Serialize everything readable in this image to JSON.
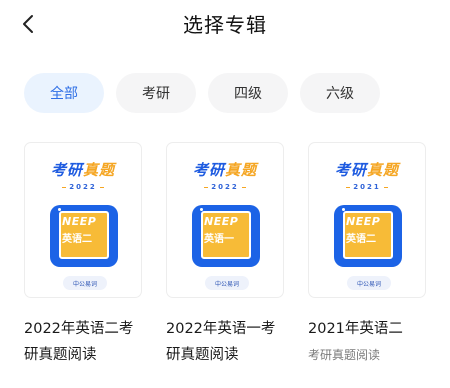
{
  "header": {
    "title": "选择专辑"
  },
  "filters": [
    "全部",
    "考研",
    "四级",
    "六级"
  ],
  "albums": [
    {
      "cover": {
        "brand_a": "考研",
        "brand_b": "真题",
        "year": "2022",
        "neep": "NEEP",
        "subject": "英语二",
        "publisher": "中公易词"
      },
      "title_line1": "2022年英语二考",
      "title_line2": "研真题阅读",
      "subtitle": ""
    },
    {
      "cover": {
        "brand_a": "考研",
        "brand_b": "真题",
        "year": "2022",
        "neep": "NEEP",
        "subject": "英语一",
        "publisher": "中公易词"
      },
      "title_line1": "2022年英语一考",
      "title_line2": "研真题阅读",
      "subtitle": ""
    },
    {
      "cover": {
        "brand_a": "考研",
        "brand_b": "真题",
        "year": "2021",
        "neep": "NEEP",
        "subject": "英语二",
        "publisher": "中公易词"
      },
      "title_line1": "2021年英语二",
      "title_line2": "",
      "subtitle": "考研真题阅读"
    }
  ],
  "colors": {
    "accent": "#2f6fe6",
    "chip_bg": "#f5f5f6",
    "chip_active_bg": "#eaf3fe",
    "brand_blue": "#1e5be0",
    "brand_yellow": "#f5a623"
  },
  "icons": {
    "back": "chevron-left-icon"
  }
}
